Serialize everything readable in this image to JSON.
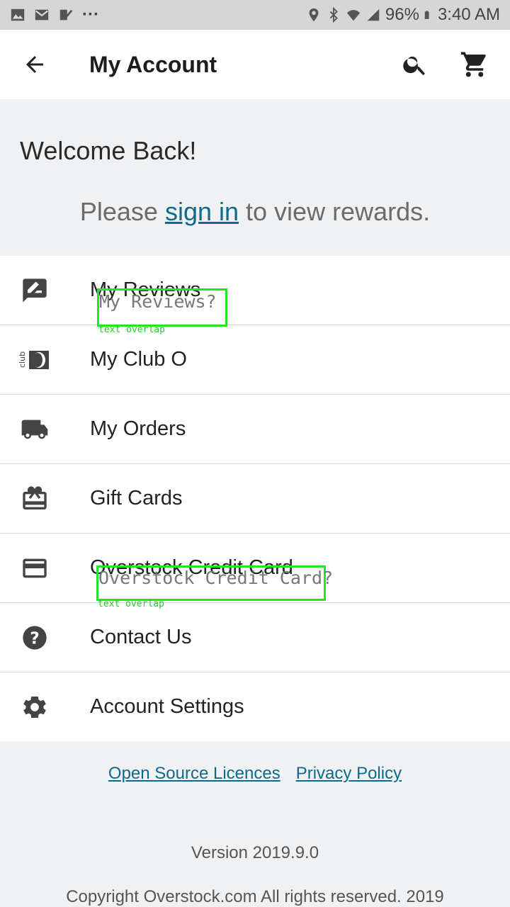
{
  "status_bar": {
    "battery": "96%",
    "time": "3:40 AM",
    "more": "···",
    "icons": [
      "gallery-icon",
      "gmail-icon",
      "check-icon",
      "location-icon",
      "bluetooth-icon",
      "wifi-icon",
      "signal-icon",
      "battery-icon"
    ]
  },
  "app_bar": {
    "title": "My Account",
    "icons": [
      "back-arrow-icon",
      "search-icon",
      "cart-icon"
    ]
  },
  "welcome": {
    "title": "Welcome Back!",
    "prefix": "Please ",
    "link": "sign in",
    "suffix": " to view rewards."
  },
  "menu": {
    "items": [
      {
        "label": "My Reviews",
        "icon": "rate-review-icon"
      },
      {
        "label": "My Club O",
        "icon": "club-o-icon"
      },
      {
        "label": "My Orders",
        "icon": "truck-icon"
      },
      {
        "label": "Gift Cards",
        "icon": "gift-card-icon"
      },
      {
        "label": "Overstock Credit Card",
        "icon": "credit-card-icon"
      },
      {
        "label": "Contact Us",
        "icon": "help-icon"
      },
      {
        "label": "Account Settings",
        "icon": "gear-icon"
      }
    ]
  },
  "overlays": [
    {
      "text": "My Reviews?",
      "tag": "text overlap"
    },
    {
      "text": "Overstock Credit Card?",
      "tag": "text overlap"
    }
  ],
  "footer": {
    "link_open_source": "Open Source Licences",
    "link_privacy": "Privacy Policy",
    "version": "Version 2019.9.0",
    "copyright": "Copyright Overstock.com All rights reserved. 2019"
  },
  "colors": {
    "accent_link": "#0e6a8c",
    "background": "#f0f1f3",
    "overlay_green": "#22e622"
  }
}
